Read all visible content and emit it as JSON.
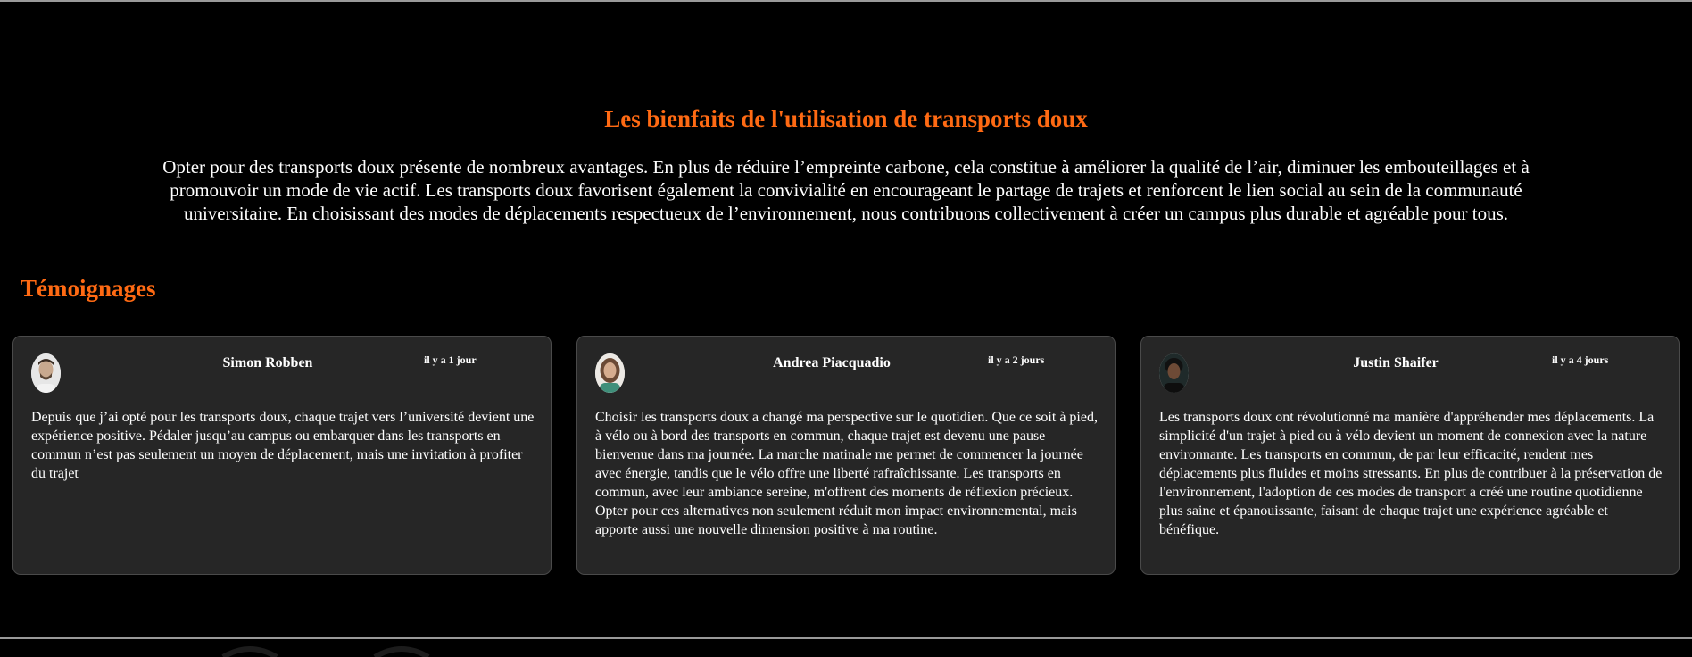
{
  "hero": {
    "title": "Les bienfaits de l'utilisation de transports doux",
    "text": "Opter pour des transports doux présente de nombreux avantages. En plus de réduire l’empreinte carbone, cela constitue à améliorer la qualité de l’air, diminuer les embouteillages et à promouvoir un mode de vie actif. Les transports doux favorisent également la convivialité en encourageant le partage de trajets et renforcent le lien social au sein de la communauté universitaire. En choisissant des modes de déplacements respectueux de l’environnement, nous contribuons collectivement à créer un campus plus durable et agréable pour tous."
  },
  "testimonials": {
    "title": "Témoignages",
    "items": [
      {
        "author": "Simon Robben",
        "time": "il y a 1 jour",
        "text": "Depuis que j’ai opté pour les transports doux, chaque trajet vers l’université devient une expérience positive. Pédaler jusqu’au campus ou embarquer dans les transports en commun n’est pas seulement un moyen de déplacement, mais une invitation à profiter du trajet"
      },
      {
        "author": "Andrea Piacquadio",
        "time": "il y a 2 jours",
        "text": "Choisir les transports doux a changé ma perspective sur le quotidien. Que ce soit à pied, à vélo ou à bord des transports en commun, chaque trajet est devenu une pause bienvenue dans ma journée. La marche matinale me permet de commencer la journée avec énergie, tandis que le vélo offre une liberté rafraîchissante. Les transports en commun, avec leur ambiance sereine, m'offrent des moments de réflexion précieux. Opter pour ces alternatives non seulement réduit mon impact environnemental, mais apporte aussi une nouvelle dimension positive à ma routine."
      },
      {
        "author": "Justin Shaifer",
        "time": "il y a 4 jours",
        "text": "Les transports doux ont révolutionné ma manière d'appréhender mes déplacements. La simplicité d'un trajet à pied ou à vélo devient un moment de connexion avec la nature environnante. Les transports en commun, de par leur efficacité, rendent mes déplacements plus fluides et moins stressants. En plus de contribuer à la préservation de l'environnement, l'adoption de ces modes de transport a créé une routine quotidienne plus saine et épanouissante, faisant de chaque trajet une expérience agréable et bénéfique."
      }
    ]
  },
  "colors": {
    "accent": "#ff6a13",
    "background": "#000000",
    "card": "#262626"
  }
}
